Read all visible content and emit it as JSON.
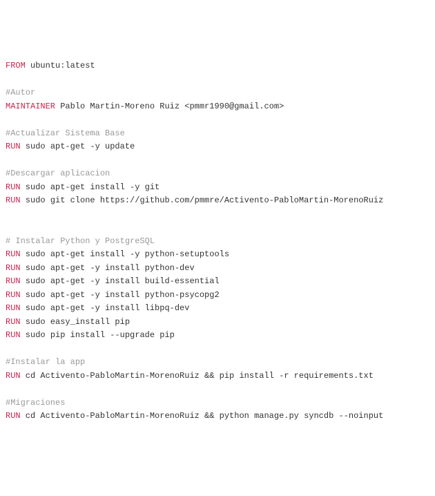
{
  "lines": [
    {
      "type": "instr",
      "keyword": "FROM",
      "rest": " ubuntu:latest"
    },
    {
      "type": "blank"
    },
    {
      "type": "comment",
      "text": "#Autor"
    },
    {
      "type": "instr",
      "keyword": "MAINTAINER",
      "rest": " Pablo Martin-Moreno Ruiz <pmmr1990@gmail.com>"
    },
    {
      "type": "blank"
    },
    {
      "type": "comment",
      "text": "#Actualizar Sistema Base"
    },
    {
      "type": "instr",
      "keyword": "RUN",
      "rest": " sudo apt-get -y update"
    },
    {
      "type": "blank"
    },
    {
      "type": "comment",
      "text": "#Descargar aplicacion"
    },
    {
      "type": "instr",
      "keyword": "RUN",
      "rest": " sudo apt-get install -y git"
    },
    {
      "type": "instr",
      "keyword": "RUN",
      "rest": " sudo git clone https://github.com/pmmre/Activento-PabloMartin-MorenoRuiz"
    },
    {
      "type": "blank"
    },
    {
      "type": "blank"
    },
    {
      "type": "comment",
      "text": "# Instalar Python y PostgreSQL"
    },
    {
      "type": "instr",
      "keyword": "RUN",
      "rest": " sudo apt-get install -y python-setuptools"
    },
    {
      "type": "instr",
      "keyword": "RUN",
      "rest": " sudo apt-get -y install python-dev"
    },
    {
      "type": "instr",
      "keyword": "RUN",
      "rest": " sudo apt-get -y install build-essential"
    },
    {
      "type": "instr",
      "keyword": "RUN",
      "rest": " sudo apt-get -y install python-psycopg2"
    },
    {
      "type": "instr",
      "keyword": "RUN",
      "rest": " sudo apt-get -y install libpq-dev"
    },
    {
      "type": "instr",
      "keyword": "RUN",
      "rest": " sudo easy_install pip"
    },
    {
      "type": "instr",
      "keyword": "RUN",
      "rest": " sudo pip install --upgrade pip"
    },
    {
      "type": "blank"
    },
    {
      "type": "comment",
      "text": "#Instalar la app"
    },
    {
      "type": "instr",
      "keyword": "RUN",
      "rest": " cd Activento-PabloMartin-MorenoRuiz && pip install -r requirements.txt"
    },
    {
      "type": "blank"
    },
    {
      "type": "comment",
      "text": "#Migraciones"
    },
    {
      "type": "instr",
      "keyword": "RUN",
      "rest": " cd Activento-PabloMartin-MorenoRuiz && python manage.py syncdb --noinput"
    }
  ]
}
